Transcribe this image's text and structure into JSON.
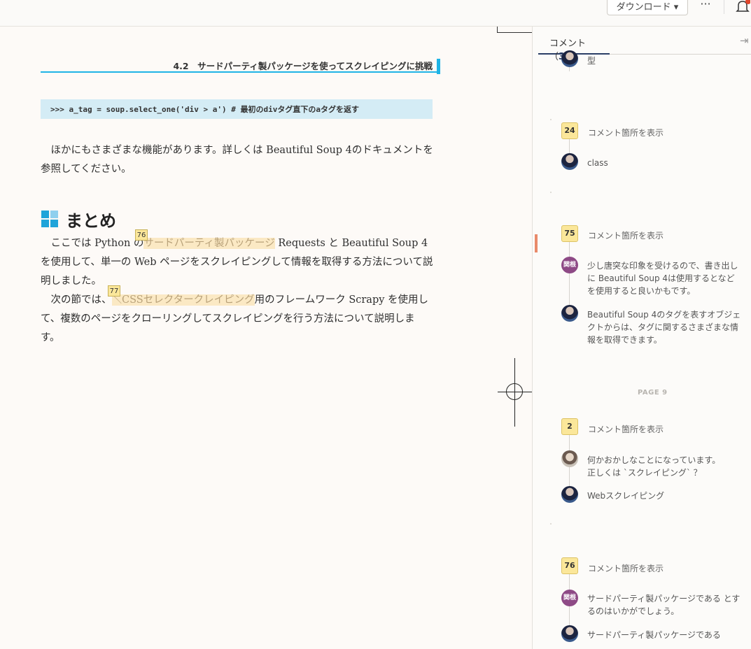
{
  "topbar": {
    "download_label": "ダウンロード ▾",
    "more_label": "···"
  },
  "doc": {
    "running_head": "4.2　サードパーティ製パッケージを使ってスクレイピングに挑戦",
    "code_line": ">>> a_tag = soup.select_one('div > a') # 最初のdivタグ直下のaタグを返す",
    "para1": "　ほかにもさまざまな機能があります。詳しくは Beautiful Soup 4のドキュメントを参照してください。",
    "section_title": "まとめ",
    "para2_a": "　ここでは Python の",
    "para2_hl": "サードパーティ製パッケージ",
    "para2_b": " Requests と Beautiful Soup 4 を使用して、単一の Web ページをスクレイピングして情報を取得する方法について説明しました。",
    "para3_a": "　次の節では、",
    "para3_hl": "＼CSSセレクタークレイピング",
    "para3_b": "用のフレームワーク Scrapy を使用して、複数のページをクローリングしてスクレイピングを行う方法について説明します。",
    "tag76": "76",
    "tag77": "77"
  },
  "panel": {
    "tab_label": "コメント（",
    "tab_count": "3",
    "tab_close": "）",
    "collapse_icon": "⇥",
    "show_link": "コメント箇所を表示",
    "page_label": "PAGE 9",
    "threads": [
      {
        "top_comment": "型"
      },
      {
        "num": "24",
        "comment": "class"
      },
      {
        "num": "75",
        "c1_badge": "関根",
        "c1": "少し唐突な印象を受けるので、書き出しに Beautiful Soup 4は使用するとなどを使用すると良いかもです。",
        "c2": "Beautiful Soup 4のタグを表すオブジェクトからは、タグに関するさまざまな情報を取得できます。"
      },
      {
        "num": "2",
        "c1": "何かおかしなことになっています。\n正しくは `スクレイピング` ？",
        "c2": "Webスクレイピング"
      },
      {
        "num": "76",
        "c1_badge": "関根",
        "c1": "サードパーティ製パッケージである とするのはいかがでしょう。",
        "c2": "サードパーティ製パッケージである"
      }
    ]
  }
}
